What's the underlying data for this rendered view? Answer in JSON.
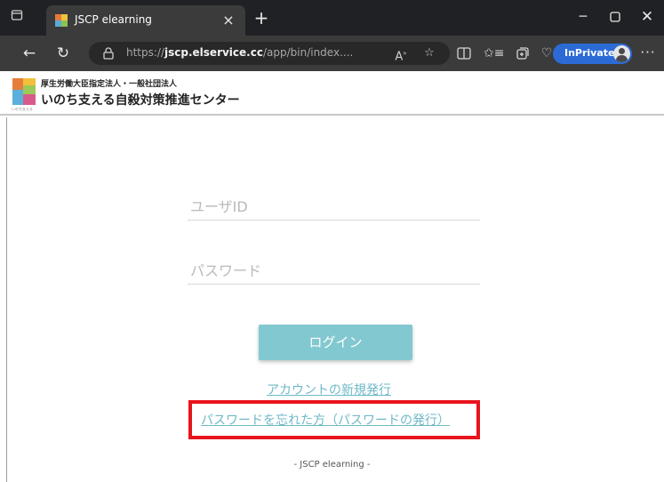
{
  "browser": {
    "tab_title": "JSCP elearning",
    "url_prefix": "https://",
    "url_host": "jscp.elservice.cc",
    "url_path": "/app/bin/index....",
    "inprivate_label": "InPrivate"
  },
  "site": {
    "org_sub": "厚生労働大臣指定法人・一般社団法人",
    "org_main": "いのち支える自殺対策推進センター",
    "logo_caption": "いのち支える"
  },
  "login": {
    "user_id_placeholder": "ユーザID",
    "password_placeholder": "パスワード",
    "login_button": "ログイン",
    "new_account_link": "アカウントの新規発行",
    "forgot_password_link": "パスワードを忘れた方（パスワードの発行）"
  },
  "footer": {
    "text": "- JSCP elearning -"
  },
  "colors": {
    "accent": "#82c8d0",
    "link": "#6fb9c7",
    "highlight": "#e8141c",
    "inprivate": "#2c6bd6"
  }
}
